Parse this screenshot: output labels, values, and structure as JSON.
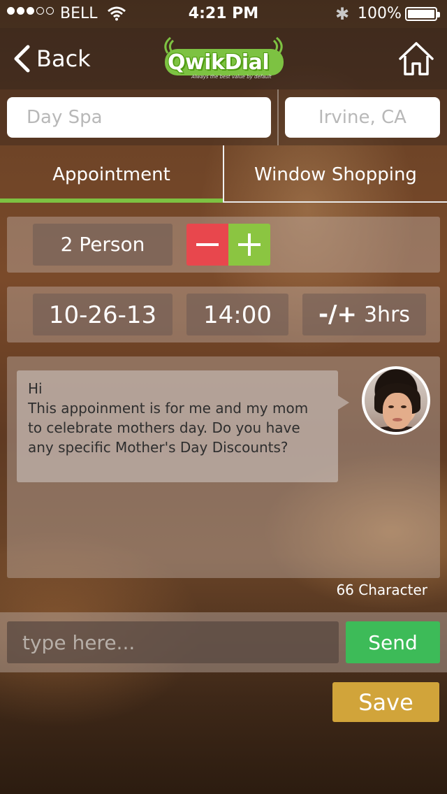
{
  "status_bar": {
    "carrier": "BELL",
    "time": "4:21 PM",
    "battery": "100%",
    "signal_bars_filled": 3,
    "signal_bars_total": 5,
    "icons": [
      "wifi-icon",
      "bluetooth-icon",
      "battery-icon"
    ]
  },
  "nav": {
    "back_label": "Back",
    "logo_text": "QwikDial",
    "logo_tagline": "Always the best value by default",
    "home_icon": "home-icon"
  },
  "search": {
    "what_placeholder": "Day Spa",
    "where_placeholder": "Irvine, CA"
  },
  "tabs": [
    {
      "label": "Appointment",
      "active": true
    },
    {
      "label": "Window Shopping",
      "active": false
    }
  ],
  "booking": {
    "persons": "2 Person",
    "minus_icon": "minus-icon",
    "plus_icon": "plus-icon",
    "date": "10-26-13",
    "time": "14:00",
    "duration_symbol": "-/+",
    "duration_value": "3hrs"
  },
  "chat": {
    "message_lines": [
      "Hi",
      "This appoinment is for me and my mom",
      "to celebrate mothers day. Do you have",
      "any specific Mother's Day Discounts?"
    ],
    "char_count": "66 Character"
  },
  "composer": {
    "placeholder": "type here...",
    "send_label": "Send"
  },
  "save_label": "Save",
  "colors": {
    "accent_green": "#7dc242",
    "minus_red": "#e8474d",
    "plus_green": "#8bc541",
    "send_green": "#3dbb58",
    "save_gold": "#d1a43a"
  }
}
